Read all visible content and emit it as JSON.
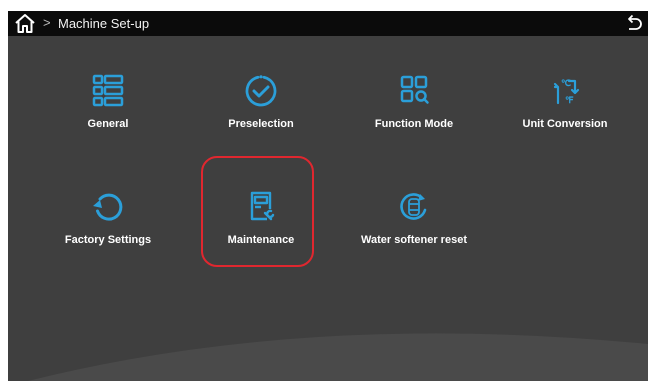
{
  "header": {
    "breadcrumb_separator": ">",
    "title": "Machine Set-up",
    "home_icon": "home-icon",
    "back_icon": "return-arrow-icon"
  },
  "colors": {
    "screen_bg": "#3f3f3f",
    "topbar_bg": "#0b0b0b",
    "icon_accent": "#2b9fd9",
    "highlight_border": "#e0272f"
  },
  "menu": {
    "items": [
      {
        "label": "General",
        "icon": "list-grid-icon"
      },
      {
        "label": "Preselection",
        "icon": "check-circle-icon"
      },
      {
        "label": "Function Mode",
        "icon": "grid-search-icon"
      },
      {
        "label": "Unit Conversion",
        "icon": "temperature-unit-swap-icon"
      },
      {
        "label": "Factory Settings",
        "icon": "reset-arrow-icon"
      },
      {
        "label": "Maintenance",
        "icon": "maintenance-wrench-icon",
        "highlighted": true
      },
      {
        "label": "Water softener reset",
        "icon": "water-softener-reset-icon"
      }
    ]
  }
}
